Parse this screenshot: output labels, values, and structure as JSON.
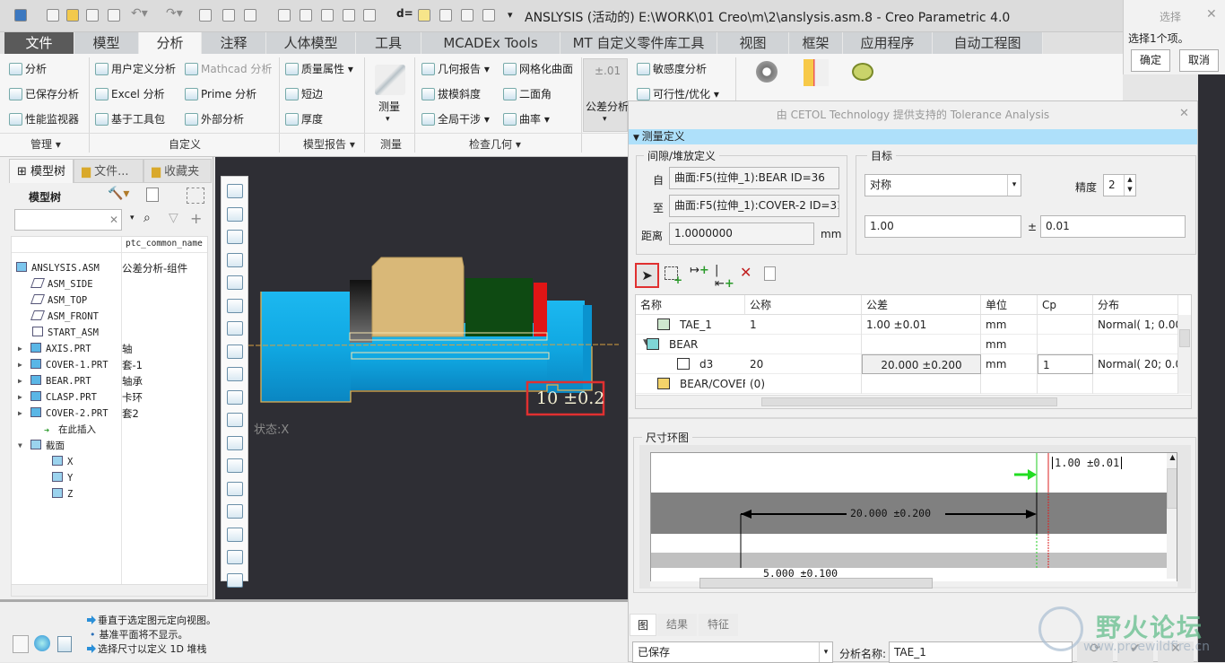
{
  "titlebar": {
    "title": "ANSLYSIS (活动的) E:\\WORK\\01 Creo\\m\\2\\anslysis.asm.8 - Creo Parametric 4.0"
  },
  "tabs": [
    "文件",
    "模型",
    "分析",
    "注释",
    "人体模型",
    "工具",
    "MCADEx Tools",
    "MT 自定义零件库工具",
    "视图",
    "框架",
    "应用程序",
    "自动工程图"
  ],
  "active_tab": "分析",
  "ribbon": {
    "items": [
      {
        "label": "分析"
      },
      {
        "label": "已保存分析"
      },
      {
        "label": "性能监视器"
      },
      {
        "label": "用户定义分析"
      },
      {
        "label": "Mathcad 分析",
        "disabled": true
      },
      {
        "label": "Excel 分析"
      },
      {
        "label": "Prime 分析"
      },
      {
        "label": "基于工具包"
      },
      {
        "label": "外部分析"
      },
      {
        "label": "质量属性 ▾"
      },
      {
        "label": "短边"
      },
      {
        "label": "厚度"
      },
      {
        "label": "几何报告 ▾"
      },
      {
        "label": "网格化曲面"
      },
      {
        "label": "拔模斜度"
      },
      {
        "label": "二面角"
      },
      {
        "label": "全局干涉 ▾"
      },
      {
        "label": "曲率 ▾"
      },
      {
        "label": "敏感度分析"
      },
      {
        "label": "可行性/优化 ▾"
      }
    ],
    "measure_label": "测量",
    "tol_label": "公差分析",
    "tol_icon_text": "±.01",
    "groups": [
      "管理 ▾",
      "自定义",
      "模型报告 ▾",
      "测量",
      "检查几何 ▾"
    ]
  },
  "select_panel": {
    "title": "选择",
    "message": "选择1个项。",
    "ok": "确定",
    "cancel": "取消"
  },
  "left_panel": {
    "tabs": [
      "模型树",
      "文件...",
      "收藏夹"
    ],
    "heading": "模型树",
    "column": "ptc_common_name",
    "search_placeholder": "",
    "tree": [
      {
        "name": "ANSLYSIS.ASM",
        "common": "公差分析-组件",
        "icon": "assembly-icon"
      },
      {
        "name": "ASM_SIDE",
        "common": "",
        "icon": "datum-plane-icon"
      },
      {
        "name": "ASM_TOP",
        "common": "",
        "icon": "datum-plane-icon"
      },
      {
        "name": "ASM_FRONT",
        "common": "",
        "icon": "datum-plane-icon"
      },
      {
        "name": "START_ASM",
        "common": "",
        "icon": "coordinate-system-icon"
      },
      {
        "name": "AXIS.PRT",
        "common": "轴",
        "icon": "part-icon"
      },
      {
        "name": "COVER-1.PRT",
        "common": "套-1",
        "icon": "part-icon"
      },
      {
        "name": "BEAR.PRT",
        "common": "轴承",
        "icon": "part-icon"
      },
      {
        "name": "CLASP.PRT",
        "common": "卡环",
        "icon": "part-icon"
      },
      {
        "name": "COVER-2.PRT",
        "common": "套2",
        "icon": "part-icon"
      },
      {
        "name": "在此插入",
        "common": "",
        "icon": "insert-here-icon"
      },
      {
        "name": "截面",
        "common": "",
        "icon": "section-icon"
      },
      {
        "name": "X",
        "common": "",
        "icon": "section-icon"
      },
      {
        "name": "Y",
        "common": "",
        "icon": "section-icon"
      },
      {
        "name": "Z",
        "common": "",
        "icon": "section-icon"
      }
    ]
  },
  "viewport": {
    "state_text": "状态:X",
    "dimension_text": "10 ±0.2"
  },
  "status": {
    "messages": [
      "垂直于选定图元定向视图。",
      "基准平面将不显示。",
      "选择尺寸以定义 1D 堆栈"
    ]
  },
  "dialog": {
    "title": "由 CETOL Technology 提供支持的 Tolerance Analysis",
    "section": "测量定义",
    "gap_group": "间隙/堆放定义",
    "from_label": "自",
    "from_value": "曲面:F5(拉伸_1):BEAR ID=36",
    "to_label": "至",
    "to_value": "曲面:F5(拉伸_1):COVER-2 ID=31",
    "dist_label": "距离",
    "dist_value": "1.0000000",
    "dist_unit": "mm",
    "target_group": "目标",
    "target_type": "对称",
    "precision_label": "精度",
    "precision_value": "2",
    "nominal": "1.00",
    "pm": "±",
    "tolerance": "0.01",
    "table": {
      "headers": [
        "名称",
        "公称",
        "公差",
        "单位",
        "Cp",
        "分布"
      ],
      "rows": [
        [
          "TAE_1",
          "1",
          "1.00 ±0.01",
          "mm",
          "",
          "Normal( 1; 0.00"
        ],
        [
          "BEAR",
          "",
          "",
          "mm",
          "",
          ""
        ],
        [
          "d3",
          "20",
          "20.000 ±0.200",
          "mm",
          "1",
          "Normal( 20; 0.0"
        ],
        [
          "BEAR/COVEF",
          "(0)",
          "",
          "",
          "",
          ""
        ]
      ]
    },
    "loop_group": "尺寸环图",
    "loop": {
      "target": "1.00 ±0.01",
      "dim1": "20.000 ±0.200",
      "dim2": "5.000 ±0.100"
    },
    "bottom_tabs": [
      "图",
      "结果",
      "特征"
    ],
    "saved_select": "已保存",
    "name_label": "分析名称:",
    "name_value": "TAE_1"
  },
  "watermark": {
    "text": "野火论坛",
    "url": "www.proewildfire.cn"
  },
  "colors": {
    "accent_blue": "#aee0fa",
    "highlight_red": "#e03030",
    "model_blue": "#12b0ea",
    "file_tab": "#5a5a5a"
  }
}
